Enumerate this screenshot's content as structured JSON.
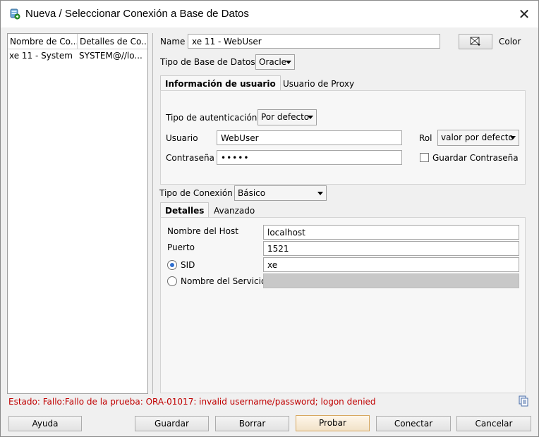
{
  "window": {
    "title": "Nueva / Seleccionar Conexión a Base de Datos"
  },
  "connections_list": {
    "columns": [
      "Nombre de Co...",
      "Detalles de Co..."
    ],
    "rows": [
      {
        "name": "xe 11 - System",
        "details": "SYSTEM@//lo..."
      }
    ]
  },
  "form": {
    "name_label": "Name",
    "name_value": "xe 11 - WebUser",
    "color_label": "Color",
    "db_type_label": "Tipo de Base de Datos",
    "db_type_value": "Oracle",
    "tabs": [
      "Información de usuario",
      "Usuario de Proxy"
    ],
    "auth_type_label": "Tipo de autenticación",
    "auth_type_value": "Por defecto",
    "user_label": "Usuario",
    "user_value": "WebUser",
    "role_label": "Rol",
    "role_value": "valor por defecto",
    "password_label": "Contraseña",
    "password_value": "•••••",
    "save_password_label": "Guardar Contraseña",
    "conn_type_label": "Tipo de Conexión",
    "conn_type_value": "Básico",
    "conn_tabs": [
      "Detalles",
      "Avanzado"
    ],
    "host_label": "Nombre del Host",
    "host_value": "localhost",
    "port_label": "Puerto",
    "port_value": "1521",
    "sid_label": "SID",
    "sid_value": "xe",
    "service_label": "Nombre del Servicio",
    "service_value": ""
  },
  "status": {
    "text": "Estado: Fallo:Fallo de la prueba: ORA-01017: invalid username/password; logon denied"
  },
  "buttons": {
    "help": "Ayuda",
    "save": "Guardar",
    "clear": "Borrar",
    "test": "Probar",
    "connect": "Conectar",
    "cancel": "Cancelar"
  },
  "colors": {
    "status_error": "#c00000",
    "radio_accent": "#2f6fd0",
    "default_button_border": "#d7a860"
  }
}
